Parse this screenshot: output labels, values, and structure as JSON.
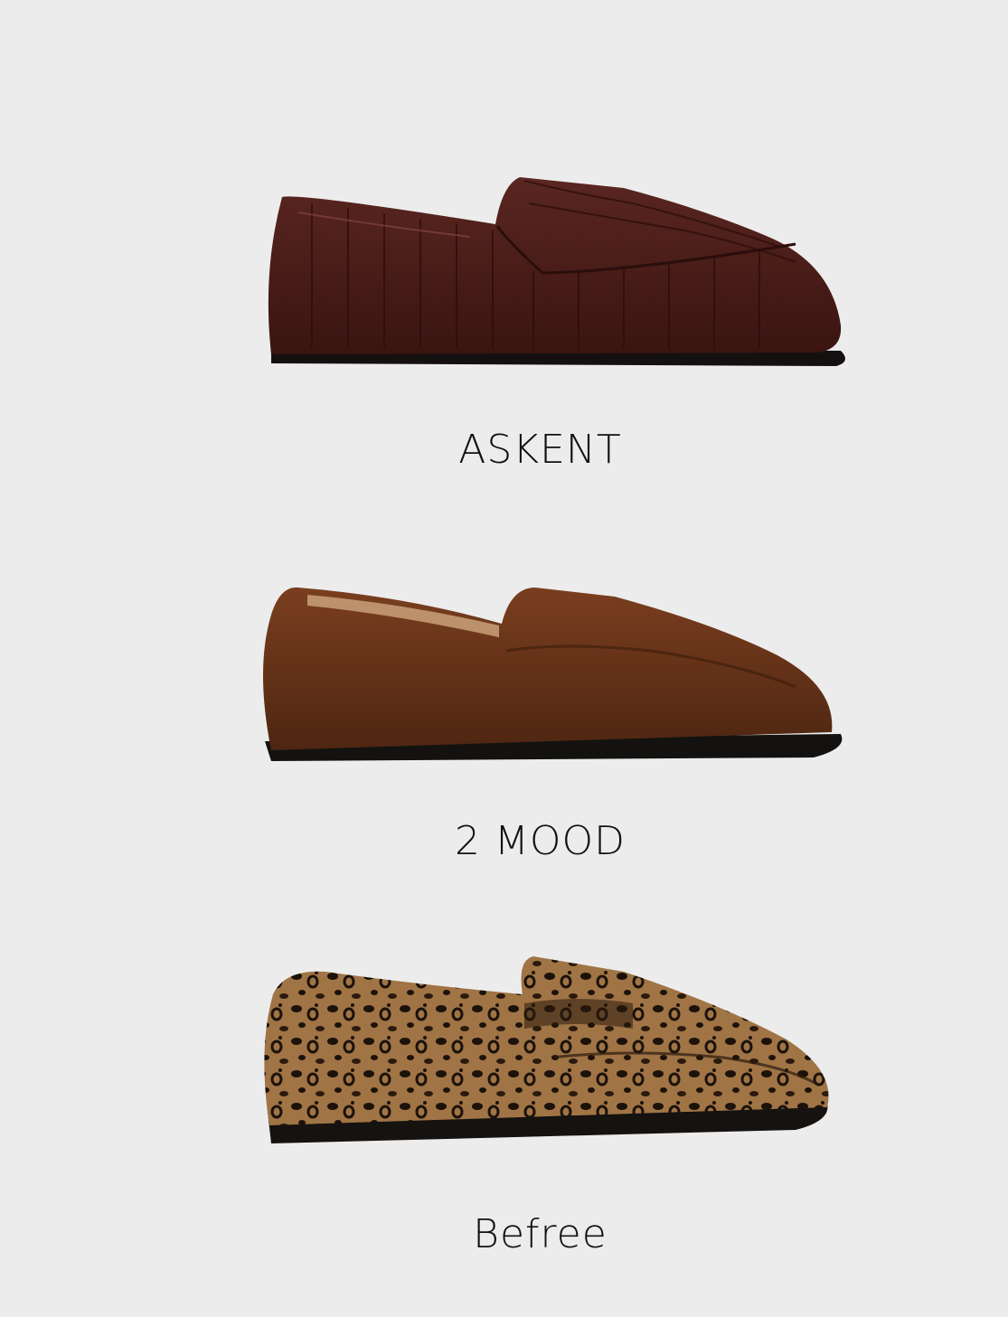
{
  "products": [
    {
      "brand": "ASKENT",
      "image": "burgundy-croc-loafer-image",
      "color": "#4a1f1b"
    },
    {
      "brand": "2 MOOD",
      "image": "brown-suede-loafer-image",
      "color": "#6b3419"
    },
    {
      "brand": "Befree",
      "image": "leopard-penny-loafer-image",
      "color": "#7a5530"
    }
  ],
  "background": "#ececec"
}
